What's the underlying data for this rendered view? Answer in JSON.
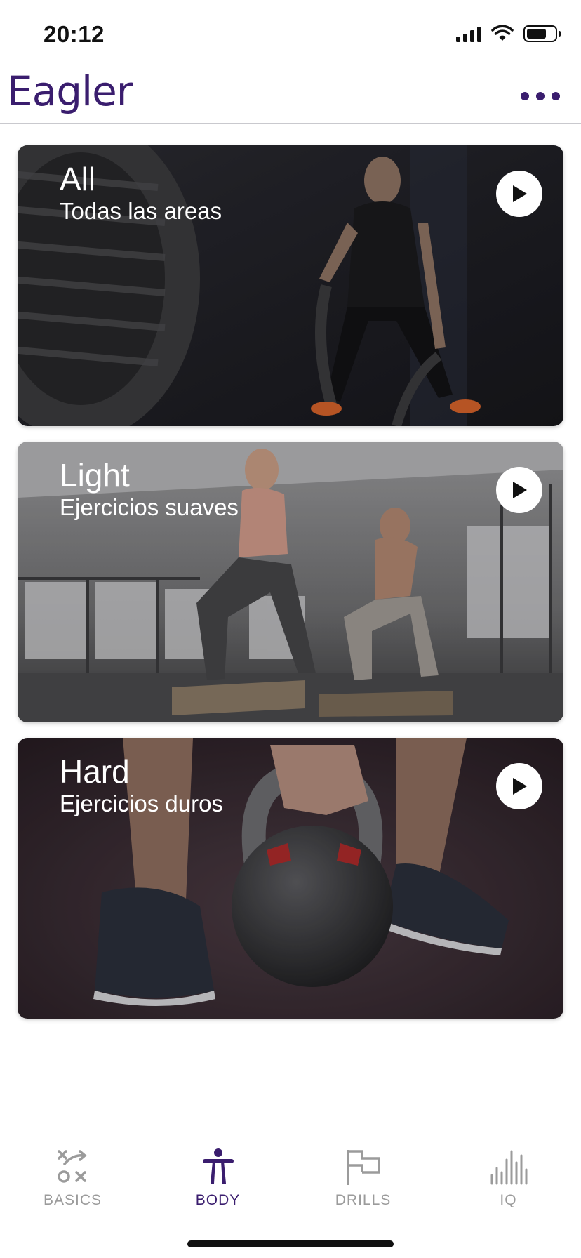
{
  "status_bar": {
    "time": "20:12"
  },
  "header": {
    "logo": "Eagler"
  },
  "colors": {
    "brand": "#3a1d6e",
    "inactive": "#9b9b9b"
  },
  "cards": [
    {
      "title": "All",
      "subtitle": "Todas las areas"
    },
    {
      "title": "Light",
      "subtitle": "Ejercicios suaves"
    },
    {
      "title": "Hard",
      "subtitle": "Ejercicios duros"
    }
  ],
  "tabs": [
    {
      "label": "BASICS",
      "icon": "tactics-icon",
      "active": false
    },
    {
      "label": "BODY",
      "icon": "body-icon",
      "active": true
    },
    {
      "label": "DRILLS",
      "icon": "flag-icon",
      "active": false
    },
    {
      "label": "IQ",
      "icon": "bars-icon",
      "active": false
    }
  ]
}
